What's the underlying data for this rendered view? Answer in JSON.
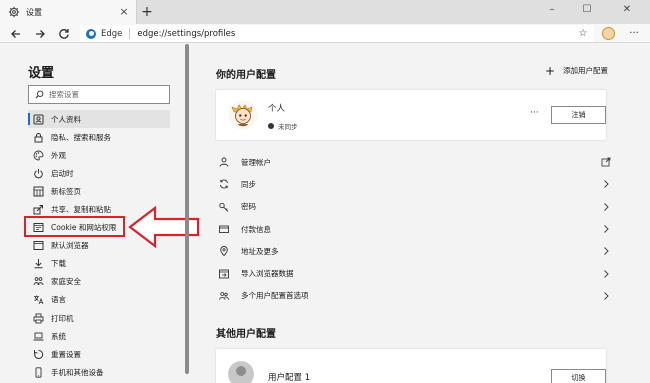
{
  "tab": {
    "title": "设置",
    "close": "×",
    "new_tab": "+"
  },
  "window_controls": {
    "minimize": "–",
    "maximize": "☐",
    "close": "✕"
  },
  "address_bar": {
    "site_label": "Edge",
    "url": "edge://settings/profiles"
  },
  "sidebar": {
    "title": "设置",
    "search_placeholder": "搜索设置",
    "items": [
      {
        "label": "个人资料",
        "icon": "profile-card-icon",
        "active": true
      },
      {
        "label": "隐私、搜索和服务",
        "icon": "lock-icon"
      },
      {
        "label": "外观",
        "icon": "palette-icon"
      },
      {
        "label": "启动时",
        "icon": "power-icon"
      },
      {
        "label": "新标签页",
        "icon": "grid-icon"
      },
      {
        "label": "共享、复制和粘贴",
        "icon": "share-icon"
      },
      {
        "label": "Cookie 和网站权限",
        "icon": "site-permissions-icon"
      },
      {
        "label": "默认浏览器",
        "icon": "browser-icon"
      },
      {
        "label": "下载",
        "icon": "download-icon"
      },
      {
        "label": "家庭安全",
        "icon": "family-icon"
      },
      {
        "label": "语言",
        "icon": "language-icon"
      },
      {
        "label": "打印机",
        "icon": "printer-icon"
      },
      {
        "label": "系统",
        "icon": "laptop-icon"
      },
      {
        "label": "重置设置",
        "icon": "reset-icon"
      },
      {
        "label": "手机和其他设备",
        "icon": "phone-icon"
      }
    ]
  },
  "main": {
    "profiles_title": "你的用户配置",
    "add_profile_label": "添加用户配置",
    "current_profile": {
      "name": "个人",
      "sync_status": "未同步",
      "more": "···",
      "logout_label": "注销"
    },
    "settings_rows": [
      {
        "label": "管理帐户",
        "icon": "person-icon",
        "trailing": "external-link-icon"
      },
      {
        "label": "同步",
        "icon": "sync-icon",
        "trailing": "chevron-right-icon"
      },
      {
        "label": "密码",
        "icon": "key-icon",
        "trailing": "chevron-right-icon"
      },
      {
        "label": "付款信息",
        "icon": "card-icon",
        "trailing": "chevron-right-icon"
      },
      {
        "label": "地址及更多",
        "icon": "location-icon",
        "trailing": "chevron-right-icon"
      },
      {
        "label": "导入浏览器数据",
        "icon": "import-icon",
        "trailing": "chevron-right-icon"
      },
      {
        "label": "多个用户配置首选项",
        "icon": "multi-profile-icon",
        "trailing": "chevron-right-icon"
      }
    ],
    "other_profiles_title": "其他用户配置",
    "other_profile": {
      "name": "用户配置 1",
      "switch_label": "切换"
    }
  },
  "colors": {
    "accent": "#1a6fc4",
    "annotation_red": "#d6242c"
  }
}
